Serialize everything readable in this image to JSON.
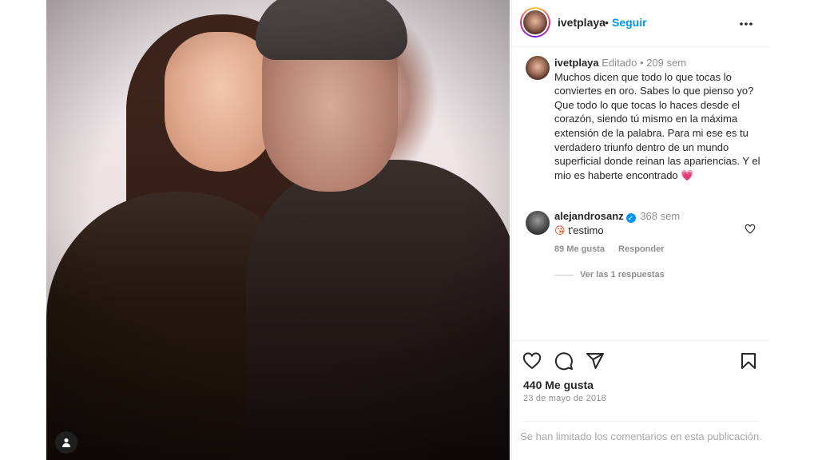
{
  "header": {
    "username": "ivetplaya",
    "separator": "•",
    "follow_label": "Seguir",
    "more_icon": "more-horizontal-icon"
  },
  "caption": {
    "username": "ivetplaya",
    "edited": "Editado",
    "separator": "•",
    "time": "209 sem",
    "text": "Muchos dicen que todo lo que tocas lo conviertes en oro. Sabes lo que pienso yo? Que todo lo que tocas lo haces desde el corazón, siendo tú mismo en la máxima extensión de la palabra. Para mi ese es tu verdadero triunfo dentro de un mundo superficial donde reinan las apariencias. Y el mio es haberte encontrado",
    "emoji": "💗"
  },
  "comment": {
    "username": "alejandrosanz",
    "verified_glyph": "✓",
    "time": "368 sem",
    "emoji": "😘",
    "text": "t'estimo",
    "likes": "89 Me gusta",
    "reply_label": "Responder",
    "view_replies": "Ver las 1 respuestas"
  },
  "post": {
    "likes": "440 Me gusta",
    "date": "23 de mayo de 2018",
    "comments_limited": "Se han limitado los comentarios en esta publicación."
  },
  "colors": {
    "accent": "#0095f6",
    "text": "#262626",
    "muted": "#8e8e8e",
    "heart_emoji": "#e8336f"
  },
  "icons": [
    "like-heart-icon",
    "comment-icon",
    "share-icon",
    "save-bookmark-icon",
    "tag-user-icon",
    "comment-like-icon"
  ]
}
